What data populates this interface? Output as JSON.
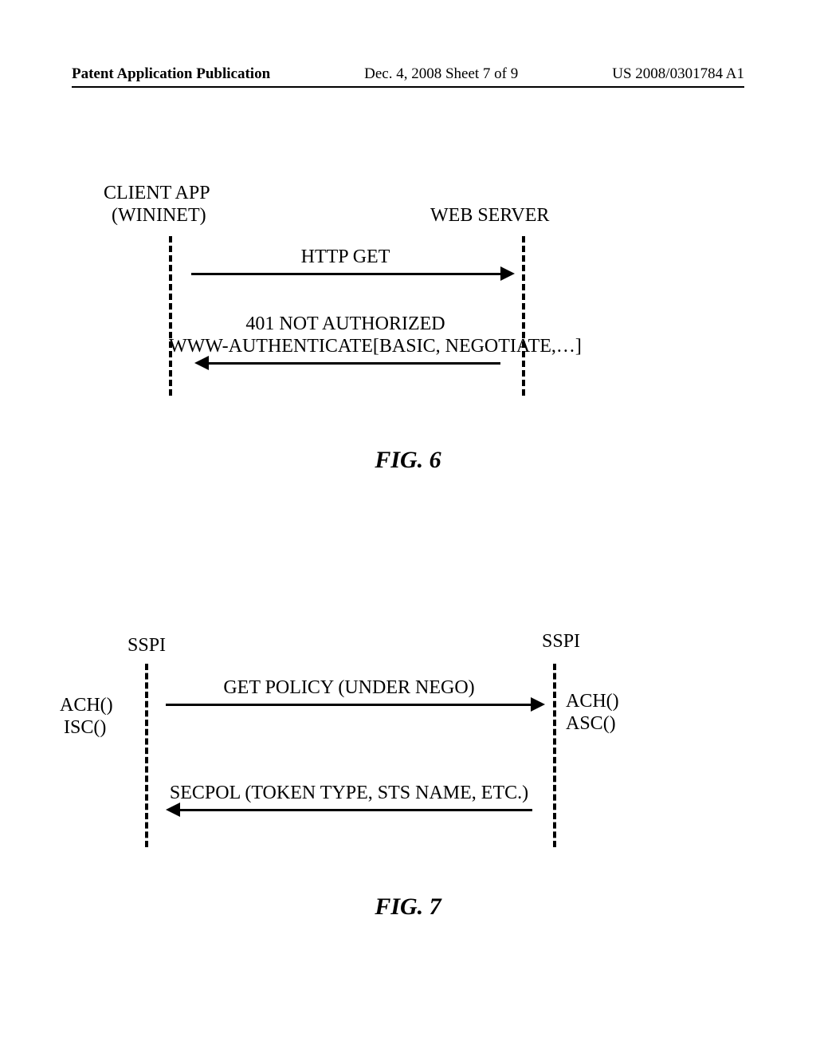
{
  "header": {
    "left": "Patent Application Publication",
    "center": "Dec. 4, 2008   Sheet 7 of 9",
    "right": "US 2008/0301784 A1"
  },
  "fig6": {
    "left_participant_line1": "CLIENT APP",
    "left_participant_line2": "(WININET)",
    "right_participant": "WEB SERVER",
    "msg1": "HTTP GET",
    "msg2_line1": "401 NOT AUTHORIZED",
    "msg2_line2": "WWW-AUTHENTICATE[BASIC, NEGOTIATE,…]",
    "caption": "FIG. 6"
  },
  "fig7": {
    "left_participant": "SSPI",
    "right_participant": "SSPI",
    "left_side_line1": "ACH()",
    "left_side_line2": "ISC()",
    "right_side_line1": "ACH()",
    "right_side_line2": "ASC()",
    "msg1": "GET POLICY (UNDER NEGO)",
    "msg2": "SECPOL (TOKEN TYPE, STS NAME, ETC.)",
    "caption": "FIG. 7"
  }
}
